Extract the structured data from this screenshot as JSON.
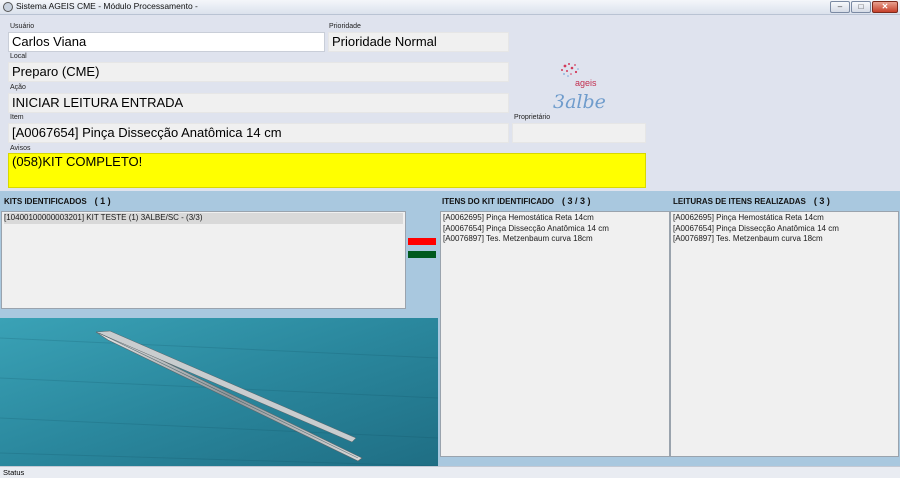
{
  "window": {
    "title": "Sistema AGEIS CME - Módulo Processamento -",
    "minimize": "–",
    "maximize": "□",
    "close": "✕"
  },
  "form": {
    "usuario": {
      "label": "Usuário",
      "value": "Carlos Viana"
    },
    "prioridade": {
      "label": "Prioridade",
      "value": "Prioridade Normal"
    },
    "local": {
      "label": "Local",
      "value": "Preparo (CME)"
    },
    "acao": {
      "label": "Ação",
      "value": "INICIAR LEITURA ENTRADA"
    },
    "item": {
      "label": "Item",
      "value": "[A0067654] Pinça Dissecção Anatômica 14 cm"
    },
    "proprietario": {
      "label": "Proprietário",
      "value": ""
    },
    "avisos": {
      "label": "Avisos",
      "value": "(058)KIT COMPLETO!"
    }
  },
  "logo": {
    "brand": "ageis",
    "sub": "3albe"
  },
  "panels": {
    "kits": {
      "title": "KITS IDENTIFICADOS",
      "count": "( 1 )",
      "rows": [
        "[10400100000003201] KIT TESTE (1) 3ALBE/SC - (3/3)"
      ]
    },
    "itens_kit": {
      "title": "ITENS DO KIT IDENTIFICADO",
      "count": "( 3 / 3 )",
      "rows": [
        "[A0062695] Pinça Hemostática Reta 14cm",
        "[A0067654] Pinça Dissecção Anatômica 14 cm",
        "[A0076897] Tes. Metzenbaum curva 18cm"
      ]
    },
    "leituras": {
      "title": "LEITURAS DE ITENS  REALIZADAS",
      "count": "( 3 )",
      "rows": [
        "[A0062695] Pinça Hemostática Reta 14cm",
        "[A0067654] Pinça Dissecção Anatômica 14 cm",
        "[A0076897] Tes. Metzenbaum curva 18cm"
      ]
    }
  },
  "indicators": {
    "red": "#ff0000",
    "green": "#005a1e"
  },
  "status": {
    "text": "Status"
  }
}
